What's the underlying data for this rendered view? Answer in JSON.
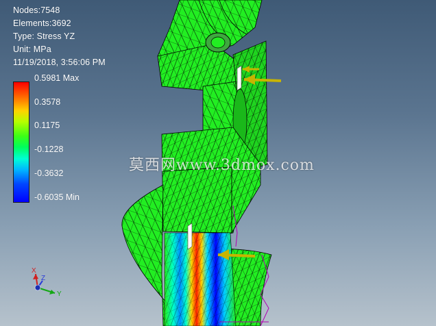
{
  "info": {
    "nodes": "Nodes:7548",
    "elements": "Elements:3692",
    "type": "Type: Stress YZ",
    "unit": "Unit: MPa",
    "timestamp": "11/19/2018, 3:56:06 PM"
  },
  "legend": {
    "labels": [
      "0.5981 Max",
      "0.3578",
      "0.1175",
      "-0.1228",
      "-0.3632",
      "-0.6035 Min"
    ]
  },
  "watermark": "莫西网www.3dmox.com",
  "triad": {
    "x": "X",
    "y": "Y",
    "z": "Z"
  },
  "colors": {
    "mesh_green": "#22ee22",
    "mesh_line": "#000000",
    "load_arrow": "#c8b400",
    "sketch_line": "#b000b0"
  }
}
